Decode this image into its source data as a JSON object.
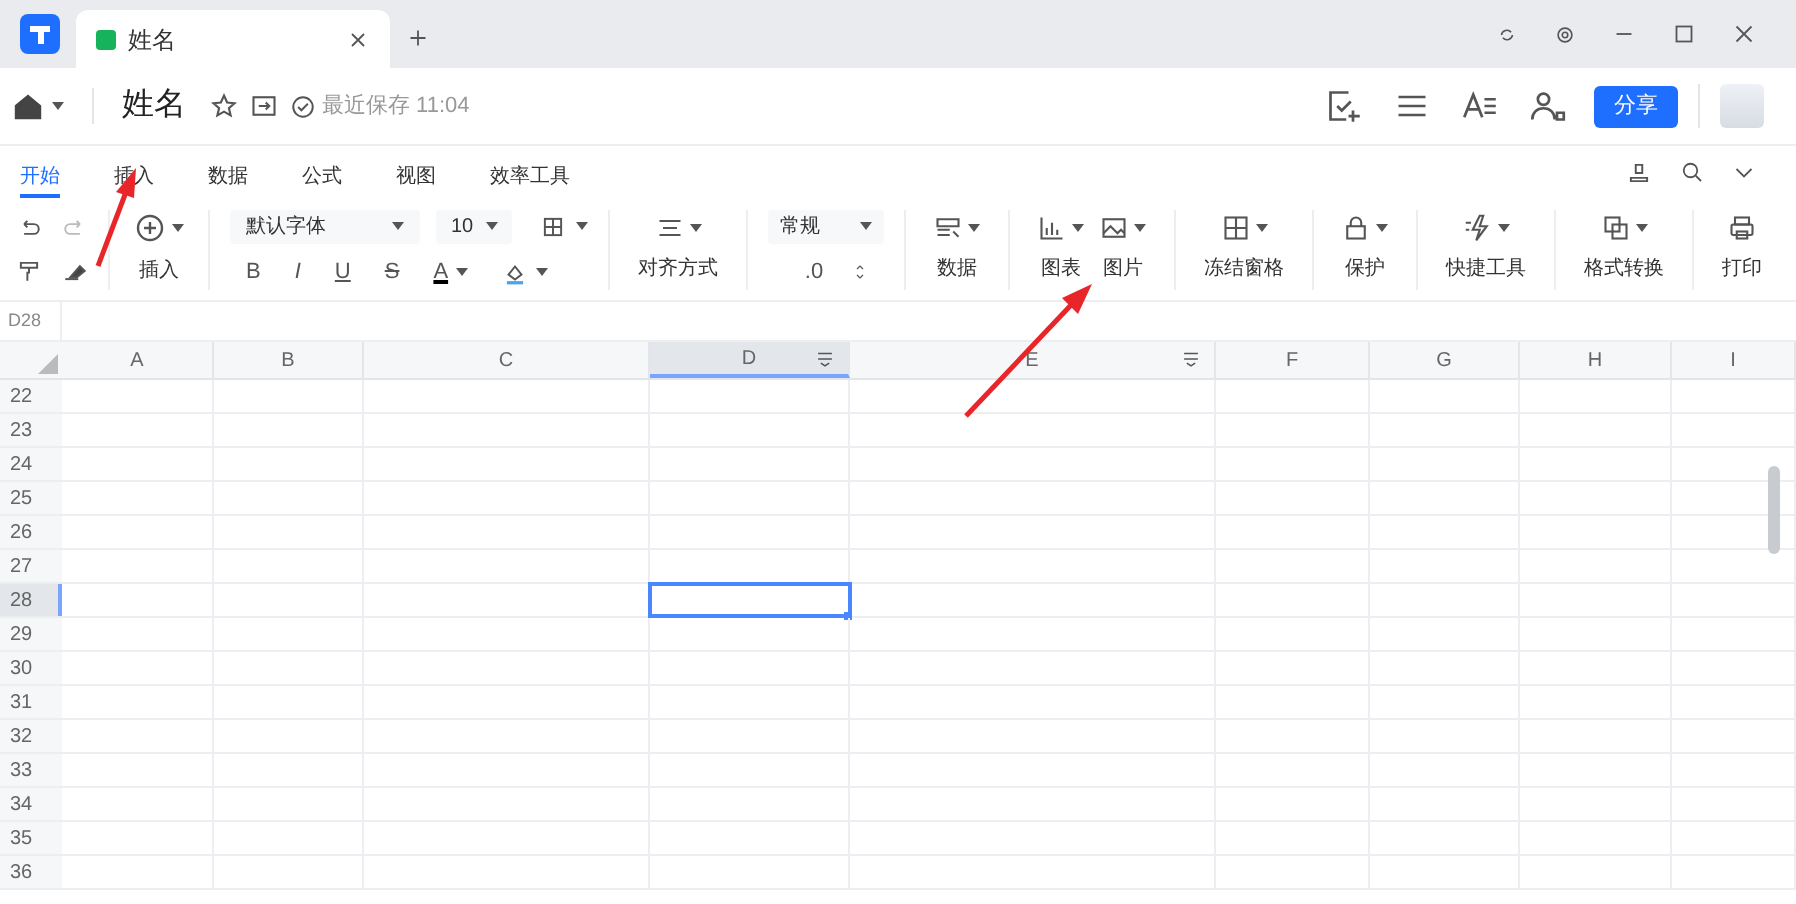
{
  "app_tabs": [
    {
      "label": "姓名",
      "selected": true
    }
  ],
  "document": {
    "title": "姓名",
    "save_status": "最近保存 11:04"
  },
  "share_button": "分享",
  "menu_tabs": [
    {
      "label": "开始",
      "selected": true
    },
    {
      "label": "插入",
      "selected": false
    },
    {
      "label": "数据",
      "selected": false
    },
    {
      "label": "公式",
      "selected": false
    },
    {
      "label": "视图",
      "selected": false
    },
    {
      "label": "效率工具",
      "selected": false
    }
  ],
  "toolbar": {
    "insert_label": "插入",
    "font": "默认字体",
    "font_size": "10",
    "format_buttons": [
      {
        "label": "B",
        "kind": "bold"
      },
      {
        "label": "I",
        "kind": "italic"
      },
      {
        "label": "U",
        "kind": "underline"
      },
      {
        "label": "S",
        "kind": "strike"
      },
      {
        "label": "A",
        "kind": "color"
      }
    ],
    "align_label": "对齐方式",
    "number_format": "常规",
    "decimal": ".0",
    "groups": [
      {
        "label": "数据",
        "kind": "data"
      },
      {
        "label": "图表",
        "kind": "chart"
      },
      {
        "label": "图片",
        "kind": "picture"
      },
      {
        "label": "冻结窗格",
        "kind": "freeze"
      },
      {
        "label": "保护",
        "kind": "protect"
      },
      {
        "label": "快捷工具",
        "kind": "quick"
      },
      {
        "label": "格式转换",
        "kind": "format"
      },
      {
        "label": "打印",
        "kind": "print"
      }
    ]
  },
  "cell_reference": "D28",
  "columns": [
    {
      "label": "A",
      "selected": false
    },
    {
      "label": "B",
      "selected": false
    },
    {
      "label": "C",
      "selected": false
    },
    {
      "label": "D",
      "selected": true,
      "filter": true
    },
    {
      "label": "E",
      "selected": false,
      "filter": true
    },
    {
      "label": "F",
      "selected": false
    },
    {
      "label": "G",
      "selected": false
    },
    {
      "label": "H",
      "selected": false
    },
    {
      "label": "I",
      "selected": false
    }
  ],
  "rows": [
    {
      "label": "22",
      "selected": false
    },
    {
      "label": "23",
      "selected": false
    },
    {
      "label": "24",
      "selected": false
    },
    {
      "label": "25",
      "selected": false
    },
    {
      "label": "26",
      "selected": false
    },
    {
      "label": "27",
      "selected": false
    },
    {
      "label": "28",
      "selected": true
    },
    {
      "label": "29",
      "selected": false
    },
    {
      "label": "30",
      "selected": false
    },
    {
      "label": "31",
      "selected": false
    },
    {
      "label": "32",
      "selected": false
    },
    {
      "label": "33",
      "selected": false
    },
    {
      "label": "34",
      "selected": false
    },
    {
      "label": "35",
      "selected": false
    },
    {
      "label": "36",
      "selected": false
    }
  ]
}
